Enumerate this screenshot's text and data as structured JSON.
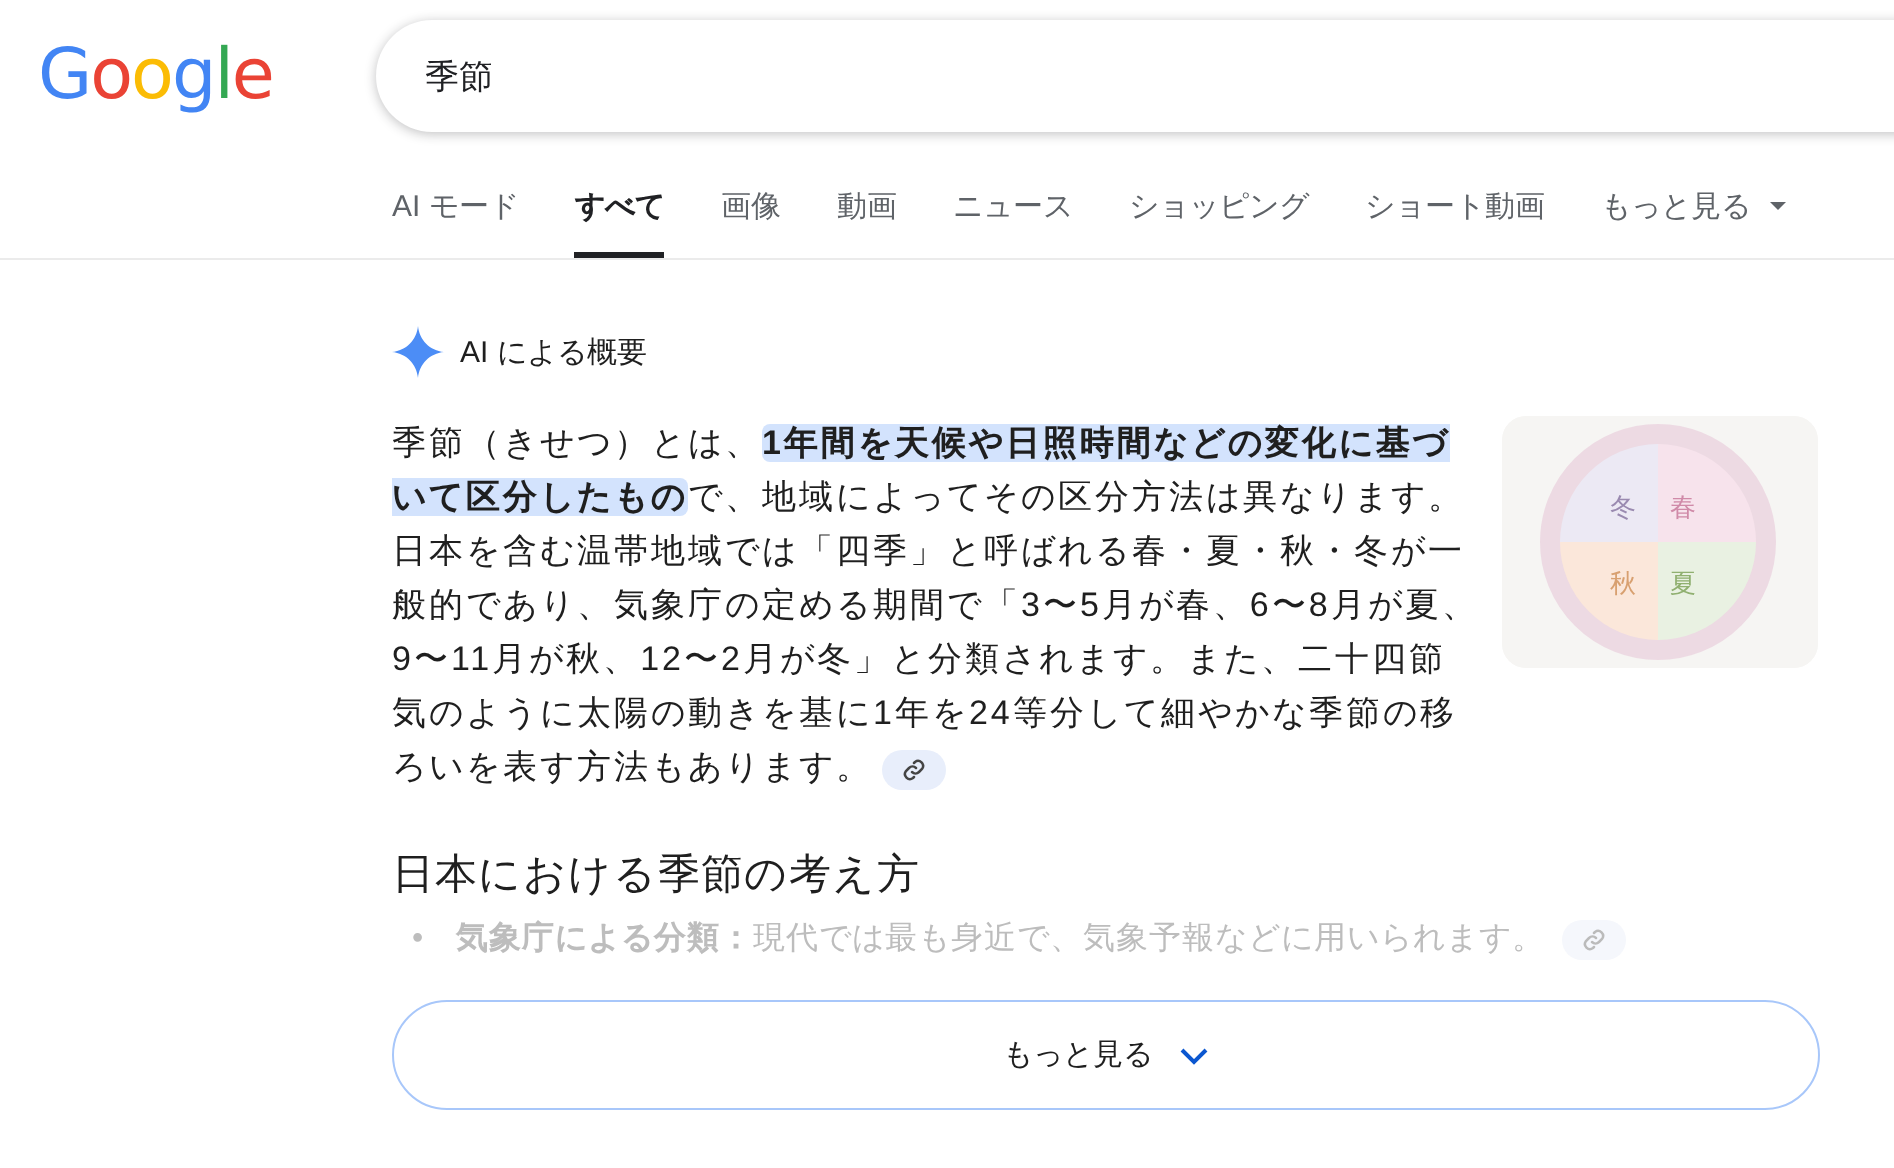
{
  "logo": "Google",
  "search": {
    "value": "季節"
  },
  "tabs": [
    {
      "label": "AI モード",
      "selected": false,
      "dropdown": false
    },
    {
      "label": "すべて",
      "selected": true,
      "dropdown": false
    },
    {
      "label": "画像",
      "selected": false,
      "dropdown": false
    },
    {
      "label": "動画",
      "selected": false,
      "dropdown": false
    },
    {
      "label": "ニュース",
      "selected": false,
      "dropdown": false
    },
    {
      "label": "ショッピング",
      "selected": false,
      "dropdown": false
    },
    {
      "label": "ショート動画",
      "selected": false,
      "dropdown": false
    },
    {
      "label": "もっと見る",
      "selected": false,
      "dropdown": true
    }
  ],
  "ai_overview": {
    "title": "AI による概要",
    "summary": "季節（きせつ）とは、**1年間を天候や日照時間などの変化に基づいて区分したもの**で、地域によってその区分方法は異なります。日本を含む温帯地域では「四季」と呼ばれる春・夏・秋・冬が一般的であり、気象庁の定める期間で「3〜5月が春、6〜8月が夏、9〜11月が秋、12〜2月が冬」と分類されます。また、二十四節気のように太陽の動きを基に1年を24等分して細やかな季節の移ろいを表す方法もあります。",
    "image_labels": [
      "冬",
      "春",
      "秋",
      "夏"
    ],
    "heading": "日本における季節の考え方",
    "bullets": [
      {
        "marker": "•",
        "text": "**気象庁による分類：**現代では最も身近で、気象予報などに用いられます。"
      }
    ],
    "more_button": "もっと見る"
  }
}
